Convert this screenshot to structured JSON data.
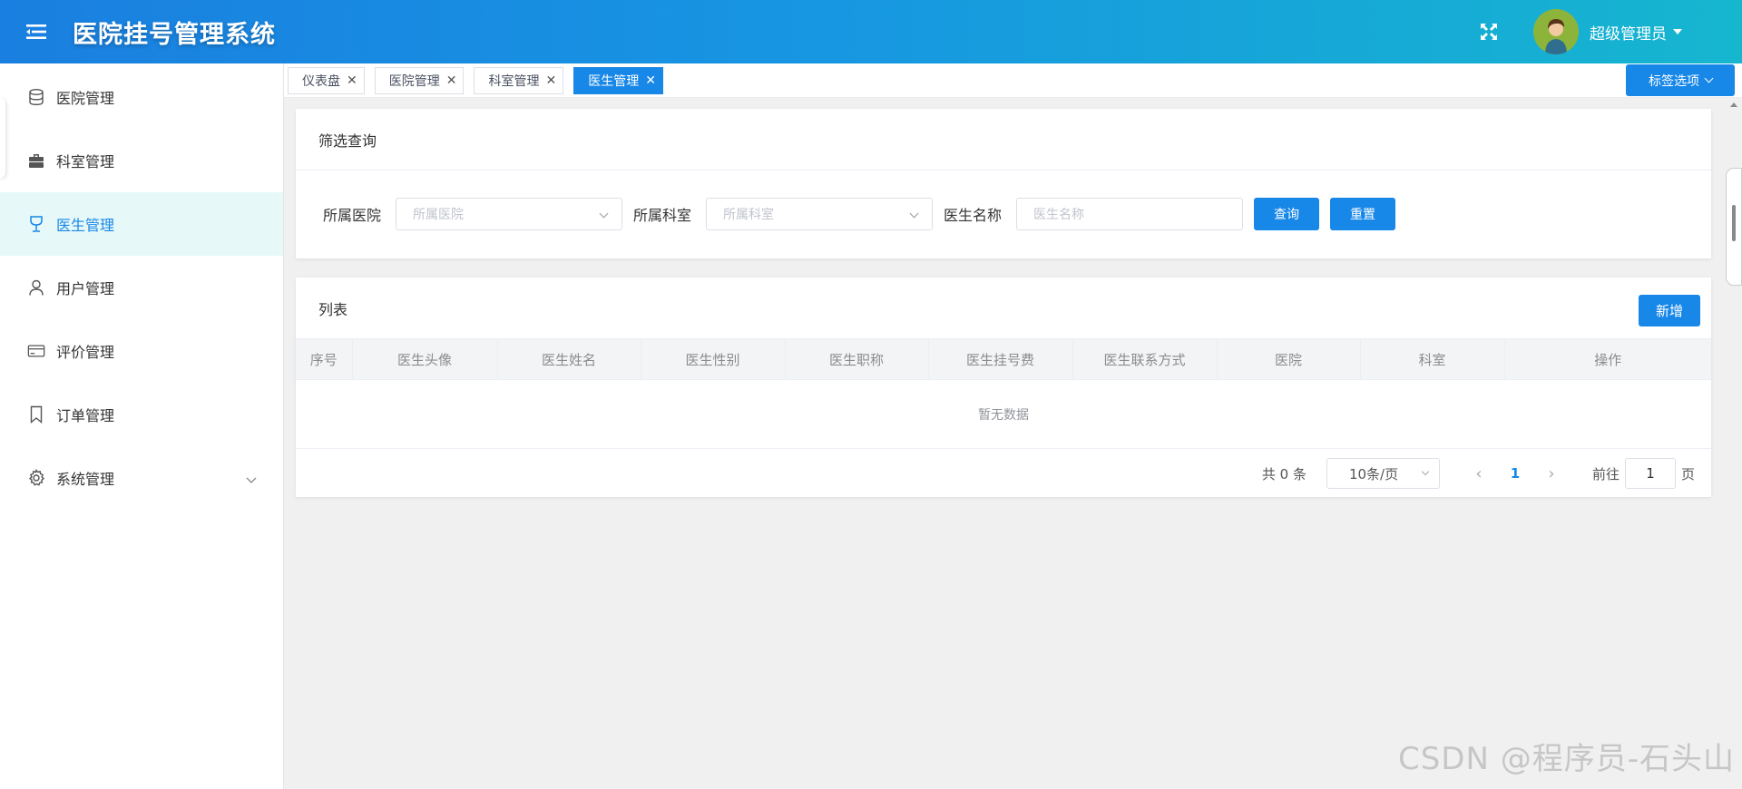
{
  "header": {
    "title": "医院挂号管理系统",
    "admin_name": "超级管理员",
    "menu_icon": "hamburger-icon",
    "fullscreen_icon": "fullscreen-icon"
  },
  "sidebar": {
    "items": [
      {
        "label": "医院管理",
        "icon": "database-icon"
      },
      {
        "label": "科室管理",
        "icon": "briefcase-icon"
      },
      {
        "label": "医生管理",
        "icon": "goblet-icon",
        "active": true
      },
      {
        "label": "用户管理",
        "icon": "user-icon"
      },
      {
        "label": "评价管理",
        "icon": "card-icon"
      },
      {
        "label": "订单管理",
        "icon": "bookmark-icon"
      },
      {
        "label": "系统管理",
        "icon": "gear-icon",
        "expandable": true
      }
    ]
  },
  "tabs": {
    "items": [
      {
        "label": "仪表盘"
      },
      {
        "label": "医院管理"
      },
      {
        "label": "科室管理"
      },
      {
        "label": "医生管理",
        "active": true
      }
    ],
    "options_label": "标签选项"
  },
  "filter": {
    "title": "筛选查询",
    "hospital_label": "所属医院",
    "hospital_placeholder": "所属医院",
    "dept_label": "所属科室",
    "dept_placeholder": "所属科室",
    "doctor_label": "医生名称",
    "doctor_placeholder": "医生名称",
    "query_label": "查询",
    "reset_label": "重置"
  },
  "list": {
    "title": "列表",
    "add_label": "新增",
    "columns": [
      "序号",
      "医生头像",
      "医生姓名",
      "医生性别",
      "医生职称",
      "医生挂号费",
      "医生联系方式",
      "医院",
      "科室",
      "操作"
    ],
    "empty_text": "暂无数据"
  },
  "pagination": {
    "total_text": "共 0 条",
    "page_size": "10条/页",
    "current_page": "1",
    "goto_label": "前往",
    "goto_value": "1",
    "page_suffix": "页"
  },
  "watermark": "CSDN @程序员-石头山",
  "colors": {
    "primary": "#1787e8",
    "active_bg": "#e6f8f8"
  }
}
